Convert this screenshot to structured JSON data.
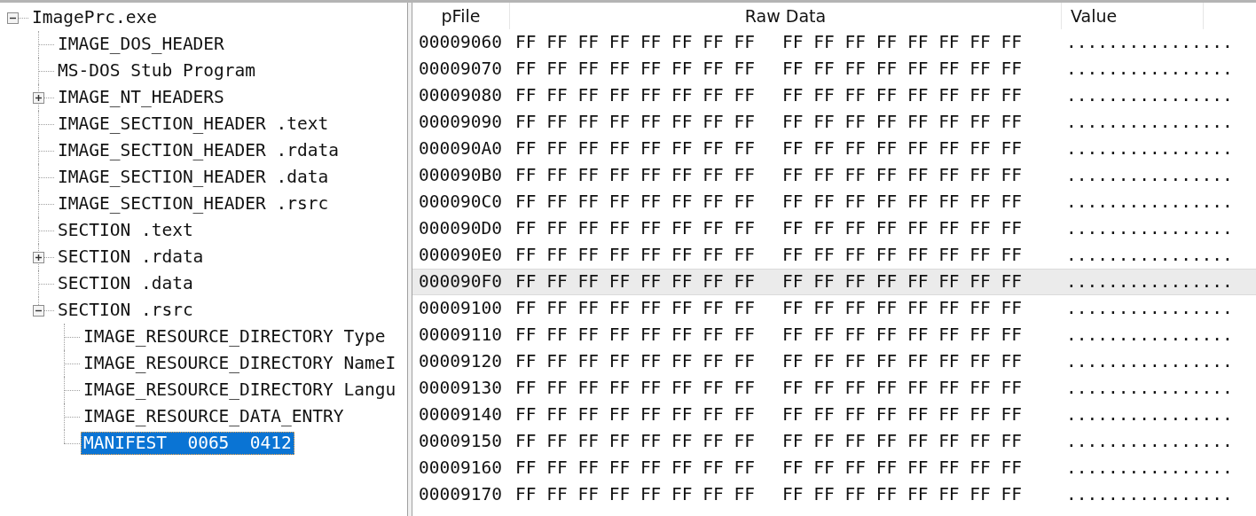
{
  "tree": [
    {
      "label": "ImagePrc.exe",
      "expanded": true,
      "selected": false,
      "children": [
        {
          "label": "IMAGE_DOS_HEADER",
          "selected": false
        },
        {
          "label": "MS-DOS Stub Program",
          "selected": false
        },
        {
          "label": "IMAGE_NT_HEADERS",
          "expanded": false,
          "selected": false
        },
        {
          "label": "IMAGE_SECTION_HEADER .text",
          "selected": false
        },
        {
          "label": "IMAGE_SECTION_HEADER .rdata",
          "selected": false
        },
        {
          "label": "IMAGE_SECTION_HEADER .data",
          "selected": false
        },
        {
          "label": "IMAGE_SECTION_HEADER .rsrc",
          "selected": false
        },
        {
          "label": "SECTION .text",
          "selected": false
        },
        {
          "label": "SECTION .rdata",
          "expanded": false,
          "selected": false
        },
        {
          "label": "SECTION .data",
          "selected": false
        },
        {
          "label": "SECTION .rsrc",
          "expanded": true,
          "selected": false,
          "children": [
            {
              "label": "IMAGE_RESOURCE_DIRECTORY Type",
              "selected": false
            },
            {
              "label": "IMAGE_RESOURCE_DIRECTORY NameI",
              "selected": false
            },
            {
              "label": "IMAGE_RESOURCE_DIRECTORY Langu",
              "selected": false
            },
            {
              "label": "IMAGE_RESOURCE_DATA_ENTRY",
              "selected": false
            },
            {
              "label": "MANIFEST  0065  0412",
              "selected": true
            }
          ]
        }
      ]
    }
  ],
  "table": {
    "columns": [
      "pFile",
      "Raw Data",
      "Value"
    ],
    "rows": [
      {
        "pfile": "00009060",
        "raw_data": [
          "FF FF FF FF FF FF FF FF",
          "FF FF FF FF FF FF FF FF"
        ],
        "value": "................",
        "selected": false
      },
      {
        "pfile": "00009070",
        "raw_data": [
          "FF FF FF FF FF FF FF FF",
          "FF FF FF FF FF FF FF FF"
        ],
        "value": "................",
        "selected": false
      },
      {
        "pfile": "00009080",
        "raw_data": [
          "FF FF FF FF FF FF FF FF",
          "FF FF FF FF FF FF FF FF"
        ],
        "value": "................",
        "selected": false
      },
      {
        "pfile": "00009090",
        "raw_data": [
          "FF FF FF FF FF FF FF FF",
          "FF FF FF FF FF FF FF FF"
        ],
        "value": "................",
        "selected": false
      },
      {
        "pfile": "000090A0",
        "raw_data": [
          "FF FF FF FF FF FF FF FF",
          "FF FF FF FF FF FF FF FF"
        ],
        "value": "................",
        "selected": false
      },
      {
        "pfile": "000090B0",
        "raw_data": [
          "FF FF FF FF FF FF FF FF",
          "FF FF FF FF FF FF FF FF"
        ],
        "value": "................",
        "selected": false
      },
      {
        "pfile": "000090C0",
        "raw_data": [
          "FF FF FF FF FF FF FF FF",
          "FF FF FF FF FF FF FF FF"
        ],
        "value": "................",
        "selected": false
      },
      {
        "pfile": "000090D0",
        "raw_data": [
          "FF FF FF FF FF FF FF FF",
          "FF FF FF FF FF FF FF FF"
        ],
        "value": "................",
        "selected": false
      },
      {
        "pfile": "000090E0",
        "raw_data": [
          "FF FF FF FF FF FF FF FF",
          "FF FF FF FF FF FF FF FF"
        ],
        "value": "................",
        "selected": false
      },
      {
        "pfile": "000090F0",
        "raw_data": [
          "FF FF FF FF FF FF FF FF",
          "FF FF FF FF FF FF FF FF"
        ],
        "value": "................",
        "selected": true
      },
      {
        "pfile": "00009100",
        "raw_data": [
          "FF FF FF FF FF FF FF FF",
          "FF FF FF FF FF FF FF FF"
        ],
        "value": "................",
        "selected": false
      },
      {
        "pfile": "00009110",
        "raw_data": [
          "FF FF FF FF FF FF FF FF",
          "FF FF FF FF FF FF FF FF"
        ],
        "value": "................",
        "selected": false
      },
      {
        "pfile": "00009120",
        "raw_data": [
          "FF FF FF FF FF FF FF FF",
          "FF FF FF FF FF FF FF FF"
        ],
        "value": "................",
        "selected": false
      },
      {
        "pfile": "00009130",
        "raw_data": [
          "FF FF FF FF FF FF FF FF",
          "FF FF FF FF FF FF FF FF"
        ],
        "value": "................",
        "selected": false
      },
      {
        "pfile": "00009140",
        "raw_data": [
          "FF FF FF FF FF FF FF FF",
          "FF FF FF FF FF FF FF FF"
        ],
        "value": "................",
        "selected": false
      },
      {
        "pfile": "00009150",
        "raw_data": [
          "FF FF FF FF FF FF FF FF",
          "FF FF FF FF FF FF FF FF"
        ],
        "value": "................",
        "selected": false
      },
      {
        "pfile": "00009160",
        "raw_data": [
          "FF FF FF FF FF FF FF FF",
          "FF FF FF FF FF FF FF FF"
        ],
        "value": "................",
        "selected": false
      },
      {
        "pfile": "00009170",
        "raw_data": [
          "FF FF FF FF FF FF FF FF",
          "FF FF FF FF FF FF FF FF"
        ],
        "value": "................",
        "selected": false
      }
    ]
  }
}
